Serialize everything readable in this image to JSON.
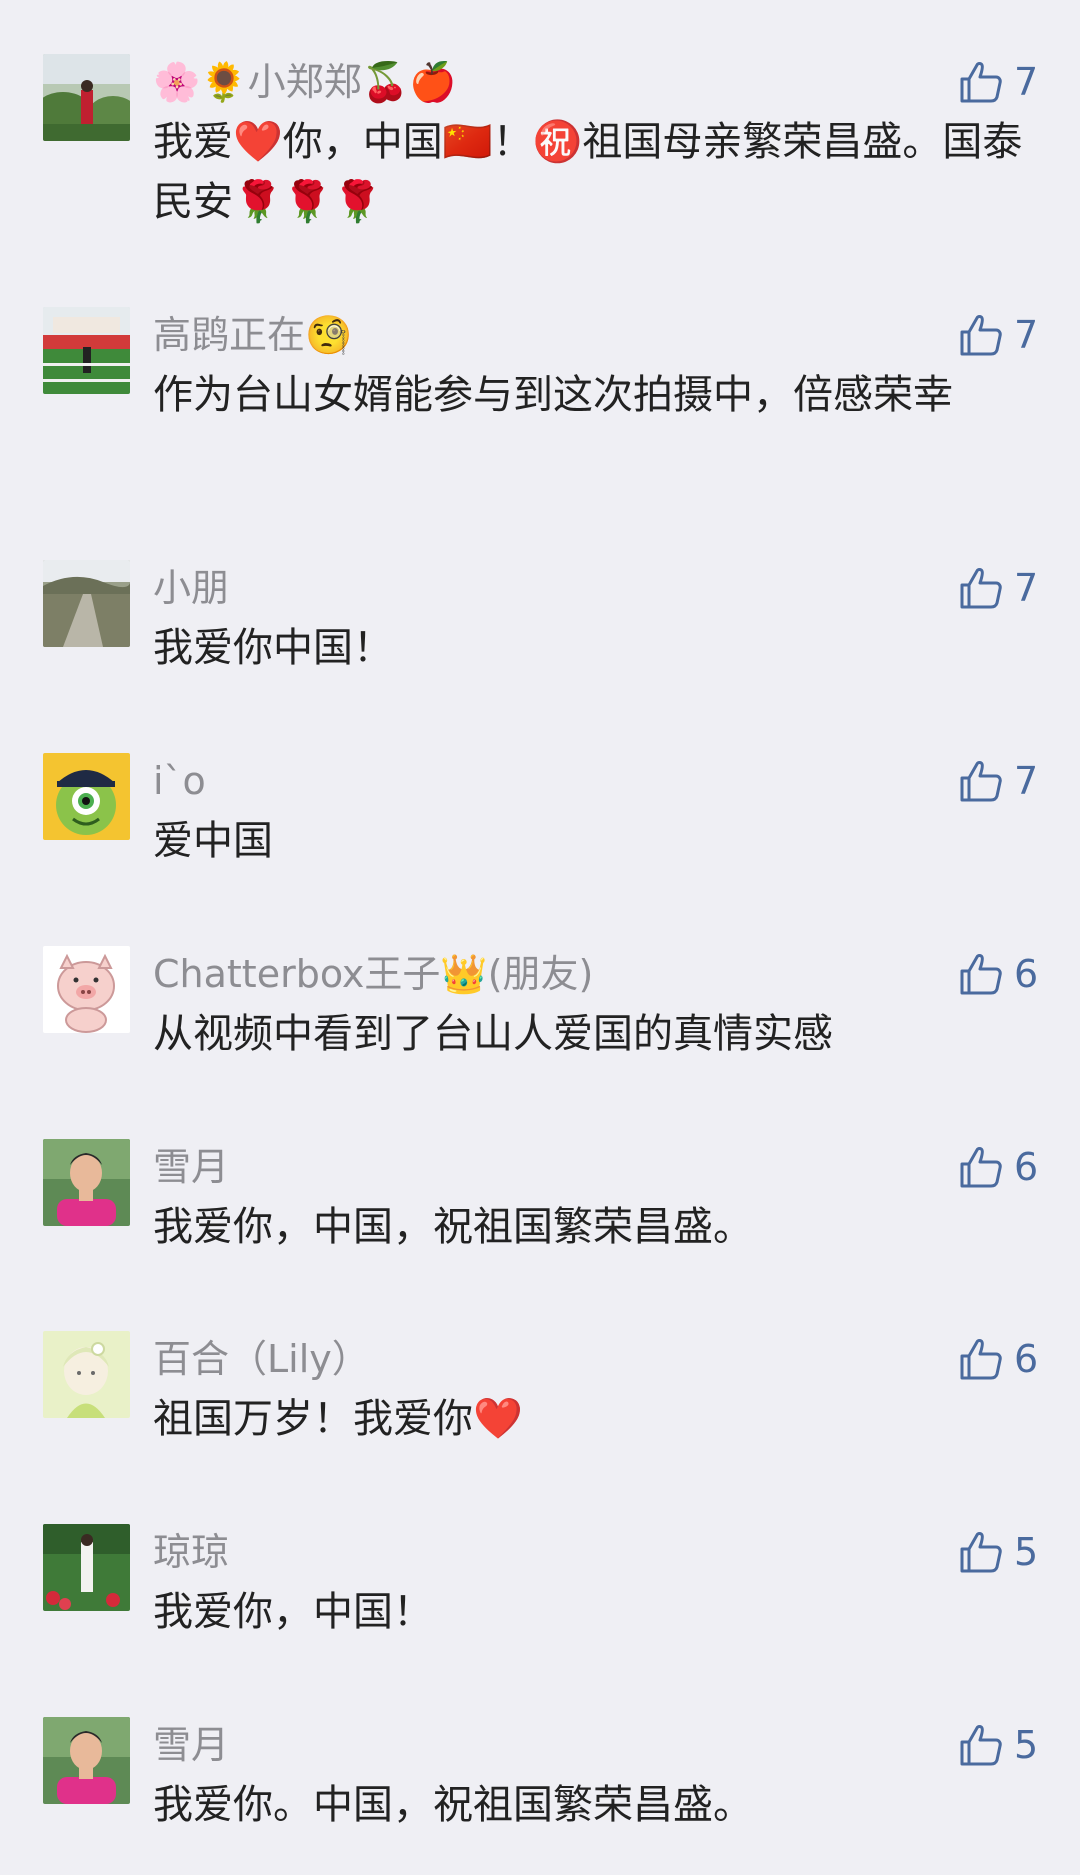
{
  "comments": [
    {
      "name": "🌸🌻小郑郑🍒🍎",
      "text": "我爱❤️你，中国🇨🇳！㊗️祖国母亲繁荣昌盛。国泰民安🌹🌹🌹",
      "likes": "7",
      "avatar": "landscape-avatar"
    },
    {
      "name": "高鹍正在🧐",
      "text": "作为台山女婿能参与到这次拍摄中，倍感荣幸",
      "likes": "7",
      "avatar": "field-avatar"
    },
    {
      "name": "小朋",
      "text": "我爱你中国！",
      "likes": "7",
      "avatar": "road-avatar"
    },
    {
      "name": "i`o",
      "text": "爱中国",
      "likes": "7",
      "avatar": "monster-avatar"
    },
    {
      "name": "Chatterbox王子👑(朋友)",
      "text": "从视频中看到了台山人爱国的真情实感",
      "likes": "6",
      "avatar": "pig-avatar"
    },
    {
      "name": "雪月",
      "text": "我爱你，中国，祝祖国繁荣昌盛。",
      "likes": "6",
      "avatar": "woman-avatar"
    },
    {
      "name": "百合（Lily）",
      "text": "祖国万岁！我爱你❤️",
      "likes": "6",
      "avatar": "girl-avatar"
    },
    {
      "name": "琼琼",
      "text": "我爱你，中国！",
      "likes": "5",
      "avatar": "garden-avatar"
    },
    {
      "name": "雪月",
      "text": "我爱你。中国，祝祖国繁荣昌盛。",
      "likes": "5",
      "avatar": "woman-avatar"
    }
  ],
  "colors": {
    "background": "#efeff4",
    "name": "#8d8d92",
    "text": "#222222",
    "like": "#4a6a9e"
  },
  "icons": {
    "like": "thumbs-up-icon"
  }
}
